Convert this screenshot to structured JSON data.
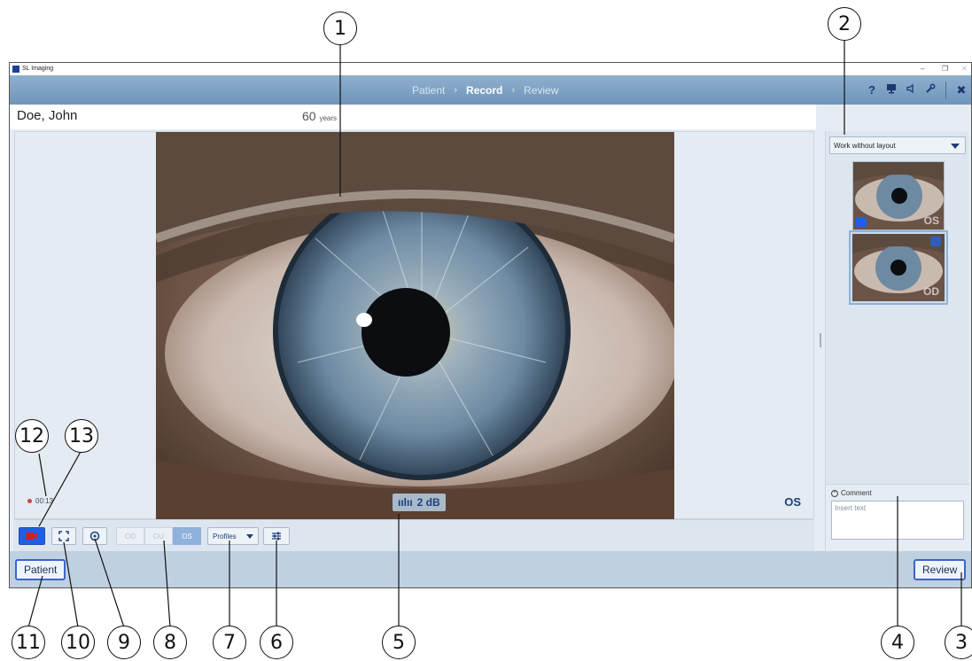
{
  "window": {
    "title": "SL Imaging",
    "min": "–",
    "restore": "❐",
    "close": "✕"
  },
  "nav": {
    "steps": [
      {
        "label": "Patient"
      },
      {
        "label": "Record"
      },
      {
        "label": "Review"
      }
    ],
    "separator": "›",
    "active_step": "Record",
    "icons": [
      "help-icon",
      "monitor-icon",
      "speaker-icon",
      "wrench-icon",
      "close-icon"
    ]
  },
  "patient": {
    "name": "Doe, John",
    "age": "60",
    "age_unit": "years"
  },
  "viewer": {
    "eye_side": "OS",
    "audio_level": "2 dB",
    "record_time": "00:13"
  },
  "toolbar": {
    "eye_options": [
      {
        "label": "OD",
        "active": false
      },
      {
        "label": "OU",
        "active": false
      },
      {
        "label": "OS",
        "active": true
      }
    ],
    "profiles_label": "Profiles"
  },
  "right_panel": {
    "layout_selected": "Work without layout",
    "thumbnails": [
      {
        "label": "OS",
        "type": "video"
      },
      {
        "label": "OD",
        "type": "image",
        "selected": true
      }
    ],
    "comment_label": "Comment",
    "comment_placeholder": "Insert text"
  },
  "bottom": {
    "patient_button": "Patient",
    "review_button": "Review"
  },
  "callouts": {
    "c1": "1",
    "c2": "2",
    "c3": "3",
    "c4": "4",
    "c5": "5",
    "c6": "6",
    "c7": "7",
    "c8": "8",
    "c9": "9",
    "c10": "10",
    "c11": "11",
    "c12": "12",
    "c13": "13"
  },
  "colors": {
    "accent": "#1e5fe6",
    "nav_bg": "#7a9dc1",
    "panel_bg": "#e5ecf3",
    "text_dark": "#1d3f7a"
  }
}
